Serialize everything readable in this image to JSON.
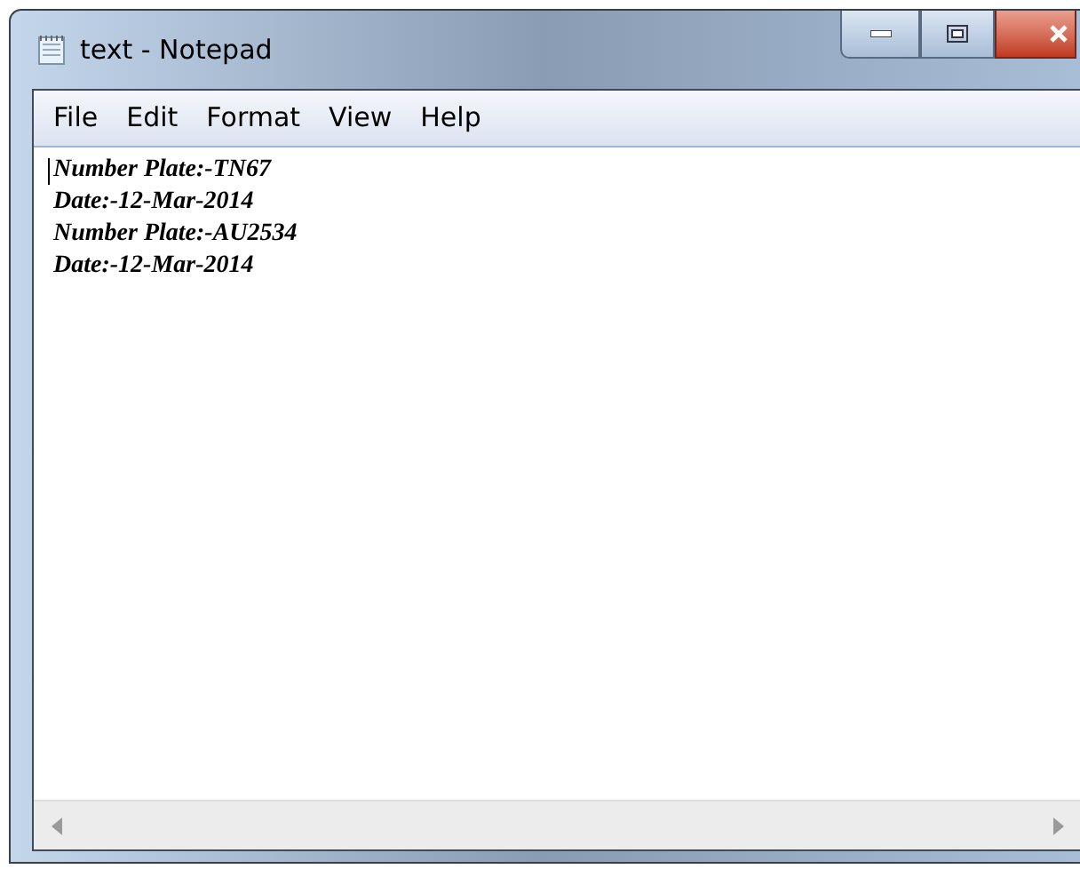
{
  "window": {
    "title": "text - Notepad"
  },
  "menu": [
    "File",
    "Edit",
    "Format",
    "View",
    "Help"
  ],
  "document": {
    "lines": [
      "Number Plate:-TN67",
      "Date:-12-Mar-2014",
      "Number Plate:-AU2534",
      "Date:-12-Mar-2014"
    ]
  }
}
